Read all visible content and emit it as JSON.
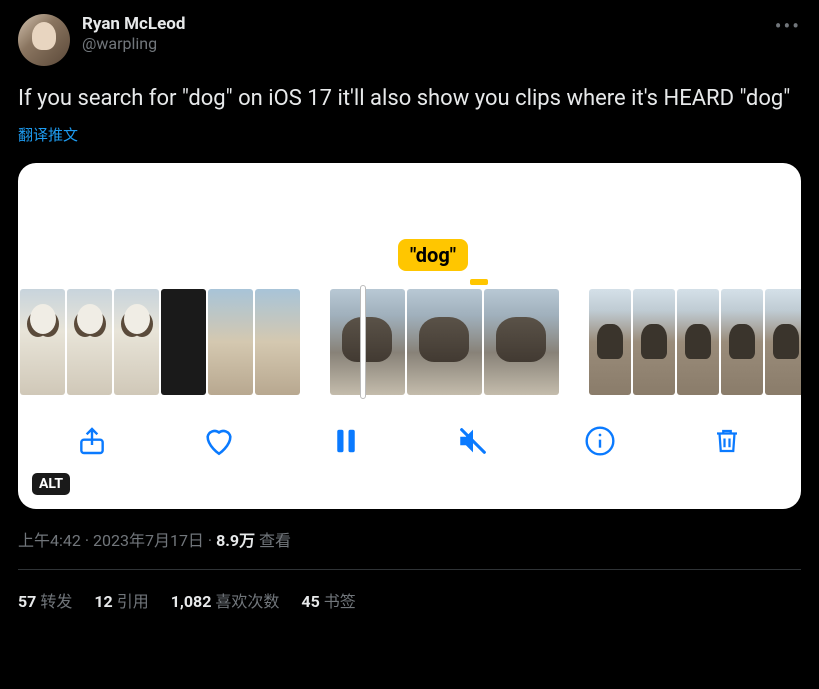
{
  "author": {
    "display_name": "Ryan McLeod",
    "handle": "@warpling"
  },
  "tweet_text": "If you search for \"dog\" on iOS 17 it'll also show you clips where it's HEARD \"dog\"",
  "translate_label": "翻译推文",
  "media": {
    "search_label": "\"dog\"",
    "alt_badge": "ALT",
    "toolbar_icons": {
      "share": "share-icon",
      "like": "heart-icon",
      "pause": "pause-icon",
      "mute": "mute-icon",
      "info": "info-icon",
      "trash": "trash-icon"
    }
  },
  "meta": {
    "time": "上午4:42",
    "date": "2023年7月17日",
    "views_count": "8.9万",
    "views_label": "查看",
    "separator": " · "
  },
  "stats": {
    "retweets": {
      "count": "57",
      "label": "转发"
    },
    "quotes": {
      "count": "12",
      "label": "引用"
    },
    "likes": {
      "count": "1,082",
      "label": "喜欢次数"
    },
    "bookmarks": {
      "count": "45",
      "label": "书签"
    }
  }
}
